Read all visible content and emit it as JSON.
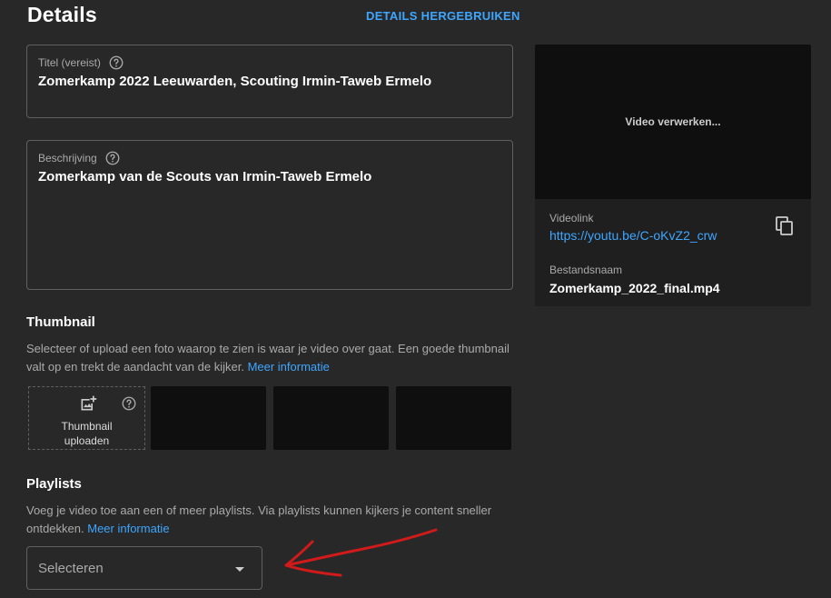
{
  "header": {
    "title": "Details",
    "reuse_label": "DETAILS HERGEBRUIKEN"
  },
  "title_field": {
    "label": "Titel (vereist)",
    "value": "Zomerkamp 2022 Leeuwarden, Scouting Irmin-Taweb Ermelo"
  },
  "description_field": {
    "label": "Beschrijving",
    "value": "Zomerkamp van de Scouts van Irmin-Taweb Ermelo"
  },
  "thumbnail": {
    "heading": "Thumbnail",
    "text_line1": "Selecteer of upload een foto waarop te zien is waar je video over gaat. Een goede thumbnail",
    "text_line2": "valt op en trekt de aandacht van de kijker.",
    "more_info": "Meer informatie",
    "upload_line1": "Thumbnail",
    "upload_line2": "uploaden"
  },
  "playlists": {
    "heading": "Playlists",
    "text_line1": "Voeg je video toe aan een of meer playlists. Via playlists kunnen kijkers je content sneller",
    "text_line2": "ontdekken.",
    "more_info": "Meer informatie",
    "select_placeholder": "Selecteren"
  },
  "side_panel": {
    "processing_text": "Video verwerken...",
    "videolink_label": "Videolink",
    "videolink_value": "https://youtu.be/C-oKvZ2_crw",
    "filename_label": "Bestandsnaam",
    "filename_value": "Zomerkamp_2022_final.mp4"
  },
  "colors": {
    "background": "#282828",
    "accent_link": "#3ea6ff",
    "annotation_arrow": "#d11a1a"
  }
}
